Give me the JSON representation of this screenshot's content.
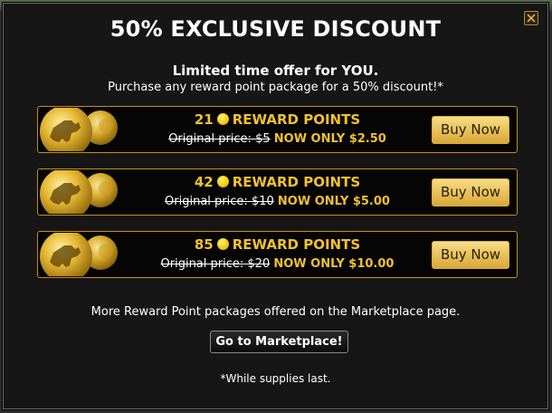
{
  "dialog": {
    "title": "50% EXCLUSIVE DISCOUNT",
    "subtitle": "Limited time offer for YOU.",
    "subtext": "Purchase any reward point package for a 50% discount!*",
    "close_icon": "close-icon"
  },
  "packages": [
    {
      "points": "21",
      "points_label": "REWARD POINTS",
      "original_label": "Original price:",
      "original_price": "$5",
      "now_price": "NOW ONLY $2.50",
      "button": "Buy Now"
    },
    {
      "points": "42",
      "points_label": "REWARD POINTS",
      "original_label": "Original price:",
      "original_price": "$10",
      "now_price": "NOW ONLY $5.00",
      "button": "Buy Now"
    },
    {
      "points": "85",
      "points_label": "REWARD POINTS",
      "original_label": "Original price:",
      "original_price": "$20",
      "now_price": "NOW ONLY $10.00",
      "button": "Buy Now"
    }
  ],
  "footer": {
    "more_text": "More Reward Point packages offered on the Marketplace page.",
    "marketplace_button": "Go to Marketplace!",
    "supplies_note": "*While supplies last."
  },
  "colors": {
    "accent_gold": "#f3c12b",
    "border_gold": "#c98d12",
    "background": "#161616"
  }
}
